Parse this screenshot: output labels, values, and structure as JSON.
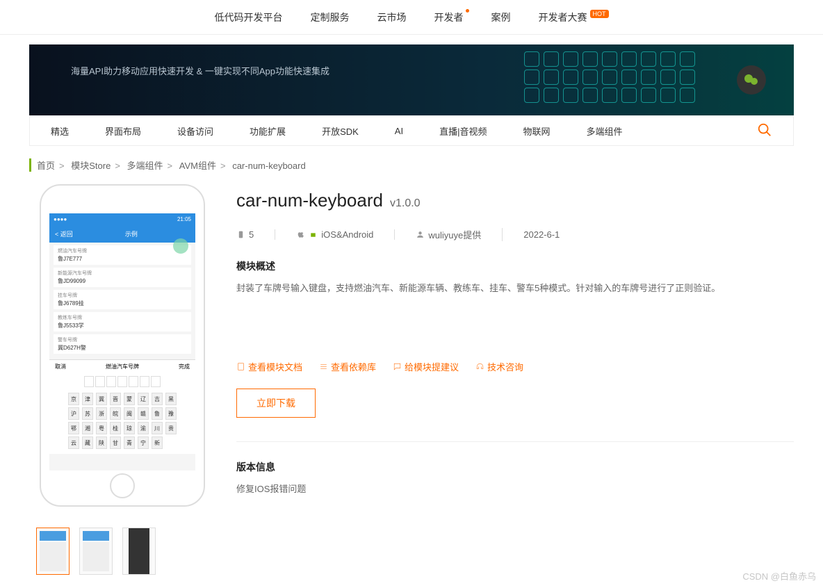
{
  "topnav": {
    "items": [
      "低代码开发平台",
      "定制服务",
      "云市场",
      "开发者",
      "案例",
      "开发者大赛"
    ],
    "hot": "HOT"
  },
  "banner": {
    "subtitle": "海量API助力移动应用快速开发 & 一键实现不同App功能快速集成"
  },
  "categories": [
    "精选",
    "界面布局",
    "设备访问",
    "功能扩展",
    "开放SDK",
    "AI",
    "直播|音视频",
    "物联网",
    "多端组件"
  ],
  "breadcrumb": {
    "items": [
      "首页",
      "模块Store",
      "多端组件",
      "AVM组件",
      "car-num-keyboard"
    ]
  },
  "detail": {
    "name": "car-num-keyboard",
    "version": "v1.0.0",
    "downloads": "5",
    "platform": "iOS&Android",
    "author": "wuliyuye提供",
    "date": "2022-6-1",
    "overview_title": "模块概述",
    "overview_text": "封装了车牌号输入键盘，支持燃油汽车、新能源车辆、教练车、挂车、警车5种模式。针对输入的车牌号进行了正则验证。",
    "actions": {
      "doc": "查看模块文档",
      "dep": "查看依赖库",
      "suggest": "给模块提建议",
      "consult": "技术咨询"
    },
    "download_btn": "立即下载",
    "version_title": "版本信息",
    "version_text": "修复IOS报错问题"
  },
  "phone": {
    "status_time": "21:05",
    "back": "返回",
    "header": "示例",
    "items": [
      {
        "label": "燃油汽车号牌",
        "value": "鲁J7E777"
      },
      {
        "label": "新能源汽车号牌",
        "value": "鲁JD99099"
      },
      {
        "label": "挂车号牌",
        "value": "鲁J6789挂"
      },
      {
        "label": "教练车号牌",
        "value": "鲁J5533学"
      },
      {
        "label": "警车号牌",
        "value": "冀D627H警"
      }
    ],
    "kb_cancel": "取消",
    "kb_title": "燃油汽车号牌",
    "kb_done": "完成",
    "kb_rows": [
      [
        "京",
        "津",
        "冀",
        "晋",
        "蒙",
        "辽",
        "吉",
        "黑"
      ],
      [
        "沪",
        "苏",
        "浙",
        "皖",
        "闽",
        "赣",
        "鲁",
        "豫"
      ],
      [
        "鄂",
        "湘",
        "粤",
        "桂",
        "琼",
        "渝",
        "川",
        "贵"
      ],
      [
        "云",
        "藏",
        "陕",
        "甘",
        "青",
        "宁",
        "新",
        ""
      ]
    ]
  },
  "watermark": "CSDN @白鱼赤乌"
}
